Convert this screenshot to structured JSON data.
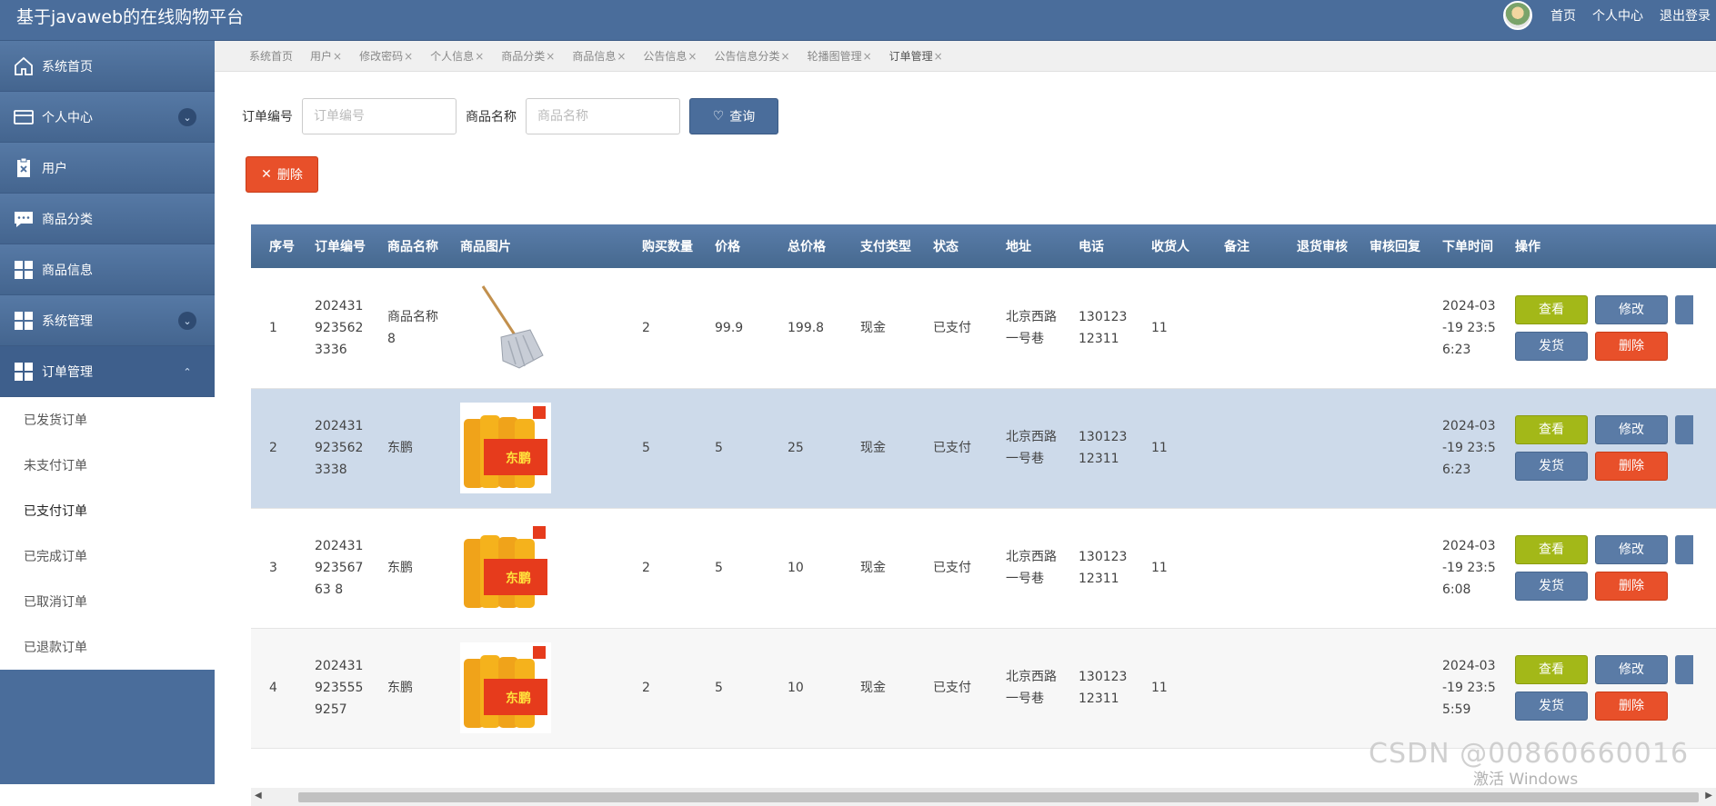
{
  "app": {
    "title": "基于javaweb的在线购物平台",
    "top_links": [
      "首页",
      "个人中心",
      "退出登录"
    ]
  },
  "sidebar": {
    "items": [
      {
        "label": "系统首页",
        "icon": "home-icon"
      },
      {
        "label": "个人中心",
        "icon": "card-icon",
        "chevron": "down"
      },
      {
        "label": "用户",
        "icon": "clipboard-x-icon"
      },
      {
        "label": "商品分类",
        "icon": "chat-icon"
      },
      {
        "label": "商品信息",
        "icon": "grid-icon"
      },
      {
        "label": "系统管理",
        "icon": "grid-icon",
        "chevron": "down"
      },
      {
        "label": "订单管理",
        "icon": "grid-icon",
        "chevron": "up"
      }
    ],
    "submenu": [
      "已发货订单",
      "未支付订单",
      "已支付订单",
      "已完成订单",
      "已取消订单",
      "已退款订单"
    ]
  },
  "tabs": [
    {
      "label": "系统首页",
      "closable": false
    },
    {
      "label": "用户",
      "closable": true
    },
    {
      "label": "修改密码",
      "closable": true
    },
    {
      "label": "个人信息",
      "closable": true
    },
    {
      "label": "商品分类",
      "closable": true
    },
    {
      "label": "商品信息",
      "closable": true
    },
    {
      "label": "公告信息",
      "closable": true
    },
    {
      "label": "公告信息分类",
      "closable": true
    },
    {
      "label": "轮播图管理",
      "closable": true
    },
    {
      "label": "订单管理",
      "closable": true
    }
  ],
  "search": {
    "order_no_label": "订单编号",
    "order_no_placeholder": "订单编号",
    "product_name_label": "商品名称",
    "product_name_placeholder": "商品名称",
    "query_button": "查询"
  },
  "delete_button": "删除",
  "table": {
    "headers": [
      "序号",
      "订单编号",
      "商品名称",
      "商品图片",
      "购买数量",
      "价格",
      "总价格",
      "支付类型",
      "状态",
      "地址",
      "电话",
      "收货人",
      "备注",
      "退货审核",
      "审核回复",
      "下单时间",
      "操作"
    ],
    "rows": [
      {
        "no": "1",
        "order_no": "2024319235623336",
        "product": "商品名称8",
        "image": "mop",
        "qty": "2",
        "price": "99.9",
        "total": "199.8",
        "pay": "现金",
        "status": "已支付",
        "address": "北京西路一号巷",
        "phone": "13012312311",
        "receiver": "11",
        "note": "",
        "return_review": "",
        "review_reply": "",
        "time": "2024-03-19 23:56:23"
      },
      {
        "no": "2",
        "order_no": "2024319235623338",
        "product": "东鹏",
        "image": "drink",
        "qty": "5",
        "price": "5",
        "total": "25",
        "pay": "现金",
        "status": "已支付",
        "address": "北京西路一号巷",
        "phone": "13012312311",
        "receiver": "11",
        "note": "",
        "return_review": "",
        "review_reply": "",
        "time": "2024-03-19 23:56:23"
      },
      {
        "no": "3",
        "order_no": "20243192356763 8",
        "product": "东鹏",
        "image": "drink",
        "qty": "2",
        "price": "5",
        "total": "10",
        "pay": "现金",
        "status": "已支付",
        "address": "北京西路一号巷",
        "phone": "13012312311",
        "receiver": "11",
        "note": "",
        "return_review": "",
        "review_reply": "",
        "time": "2024-03-19 23:56:08"
      },
      {
        "no": "4",
        "order_no": "2024319235559257",
        "product": "东鹏",
        "image": "drink",
        "qty": "2",
        "price": "5",
        "total": "10",
        "pay": "现金",
        "status": "已支付",
        "address": "北京西路一号巷",
        "phone": "13012312311",
        "receiver": "11",
        "note": "",
        "return_review": "",
        "review_reply": "",
        "time": "2024-03-19 23:55:59"
      }
    ],
    "actions": {
      "view": "查看",
      "edit": "修改",
      "ship": "发货",
      "delete": "删除"
    }
  },
  "overlay": {
    "watermark": "CSDN @00860660016",
    "activate": "激活 Windows"
  },
  "colors": {
    "primary": "#4a6d9b",
    "danger": "#e8502a",
    "view": "#a3b818",
    "selected_row": "#cddaea"
  }
}
